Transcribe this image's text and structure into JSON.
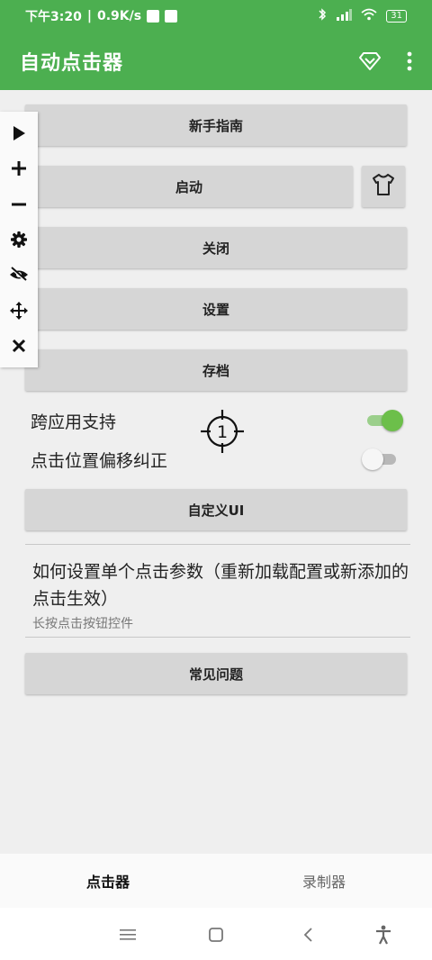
{
  "status_bar": {
    "time": "下午3:20",
    "speed": "0.9K/s",
    "battery": "31"
  },
  "app_bar": {
    "title": "自动点击器",
    "diamond_icon": "diamond-icon",
    "more_icon": "more-vert-icon"
  },
  "float_toolbar": {
    "icons": [
      "play-icon",
      "plus-icon",
      "minus-icon",
      "gear-icon",
      "eye-off-icon",
      "move-icon",
      "close-icon"
    ]
  },
  "buttons": {
    "guide": "新手指南",
    "start": "启动",
    "close": "关闭",
    "settings": "设置",
    "save": "存档",
    "custom_ui": "自定义UI",
    "faq": "常见问题"
  },
  "settings": {
    "cross_app": {
      "label": "跨应用支持",
      "enabled": true
    },
    "offset_fix": {
      "label": "点击位置偏移纠正",
      "enabled": false
    }
  },
  "target": {
    "number": "1"
  },
  "info": {
    "question": "如何设置单个点击参数（重新加载配置或新添加的点击生效）",
    "hint": "长按点击按钮控件"
  },
  "tabs": {
    "clicker": "点击器",
    "recorder": "录制器"
  },
  "colors": {
    "primary": "#4caf50",
    "toggle_on": "#6cbf4a",
    "button_bg": "#d6d6d6"
  }
}
